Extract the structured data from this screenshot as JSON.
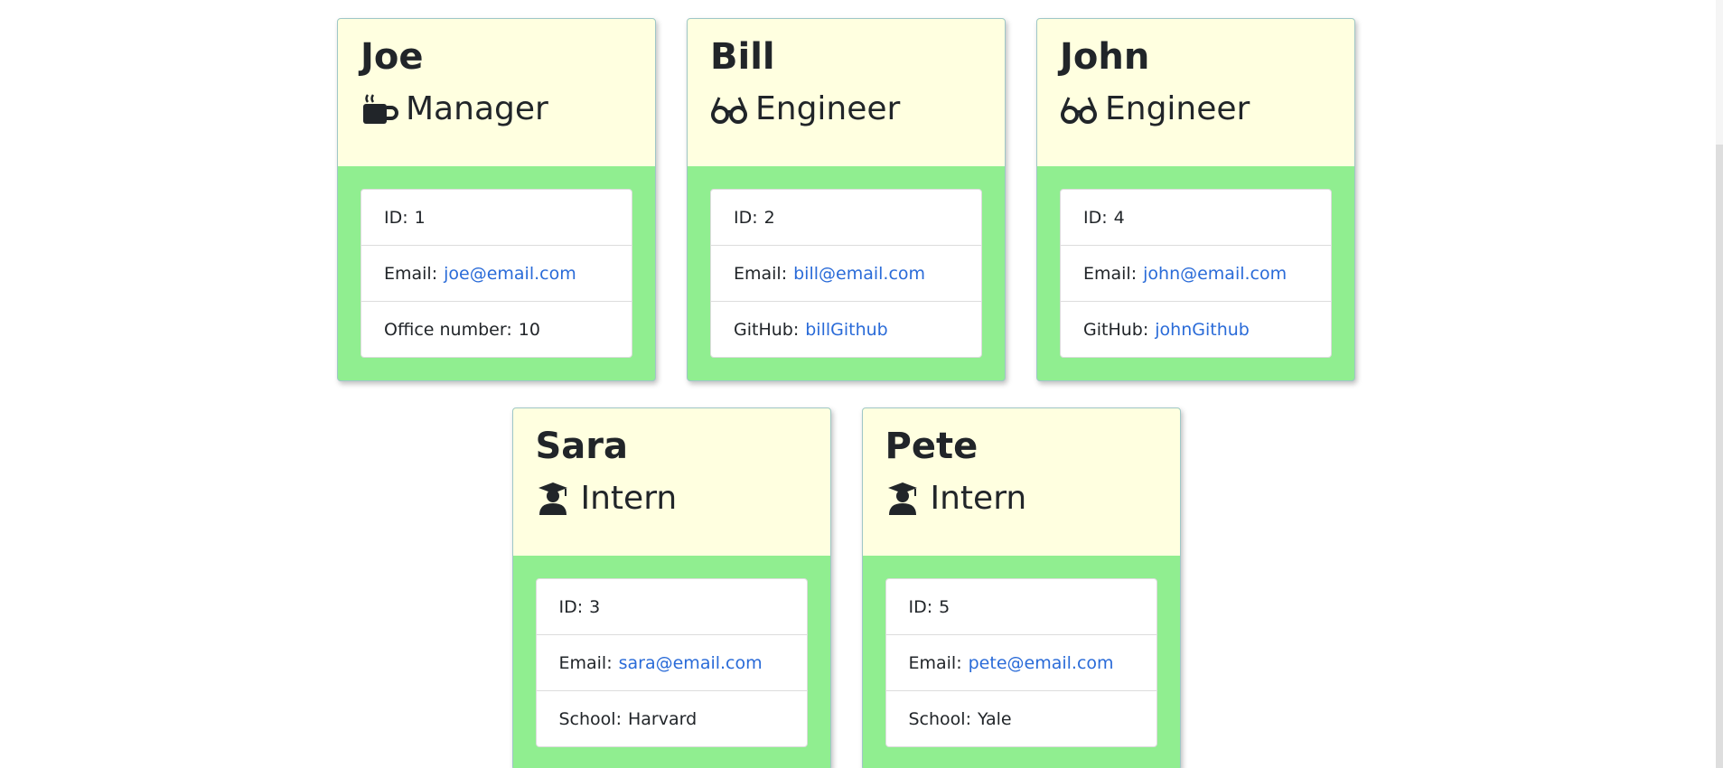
{
  "cards": [
    {
      "name": "Joe",
      "role": "Manager",
      "icon": "coffee-icon",
      "id_label": "ID:",
      "id_value": "1",
      "email_label": "Email:",
      "email": "joe@email.com",
      "extra_label": "Office number:",
      "extra_value": "10"
    },
    {
      "name": "Bill",
      "role": "Engineer",
      "icon": "glasses-icon",
      "id_label": "ID:",
      "id_value": "2",
      "email_label": "Email:",
      "email": "bill@email.com",
      "extra_label": "GitHub:",
      "extra_value": "billGithub"
    },
    {
      "name": "John",
      "role": "Engineer",
      "icon": "glasses-icon",
      "id_label": "ID:",
      "id_value": "4",
      "email_label": "Email:",
      "email": "john@email.com",
      "extra_label": "GitHub:",
      "extra_value": "johnGithub"
    },
    {
      "name": "Sara",
      "role": "Intern",
      "icon": "graduate-icon",
      "id_label": "ID:",
      "id_value": "3",
      "email_label": "Email:",
      "email": "sara@email.com",
      "extra_label": "School:",
      "extra_value": "Harvard"
    },
    {
      "name": "Pete",
      "role": "Intern",
      "icon": "graduate-icon",
      "id_label": "ID:",
      "id_value": "5",
      "email_label": "Email:",
      "email": "pete@email.com",
      "extra_label": "School:",
      "extra_value": "Yale"
    }
  ],
  "colors": {
    "header_bg": "#ffffe0",
    "body_bg": "#90ee90",
    "link": "#2a6bd8"
  }
}
